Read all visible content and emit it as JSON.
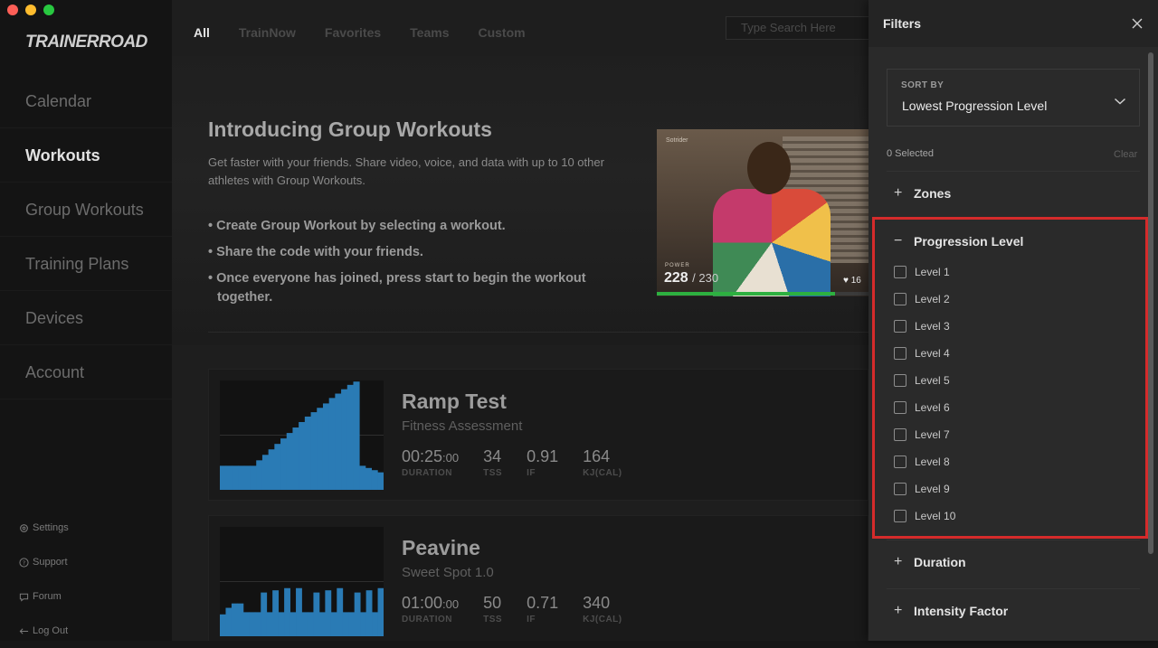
{
  "sidebar": {
    "logo": "TRAINERROAD",
    "nav": [
      "Calendar",
      "Workouts",
      "Group Workouts",
      "Training Plans",
      "Devices",
      "Account"
    ],
    "active_nav": "Workouts",
    "bottom_links": [
      {
        "label": "Settings",
        "icon": "gear-icon"
      },
      {
        "label": "Support",
        "icon": "question-icon"
      },
      {
        "label": "Forum",
        "icon": "chat-icon"
      },
      {
        "label": "Log Out",
        "icon": "arrow-left-icon"
      }
    ]
  },
  "main": {
    "tabs": [
      "All",
      "TrainNow",
      "Favorites",
      "Teams",
      "Custom"
    ],
    "active_tab": "All",
    "search_placeholder": "Type Search Here",
    "hero": {
      "title": "Introducing Group Workouts",
      "description": "Get faster with your friends. Share video, voice, and data with up to 10 other athletes with Group Workouts.",
      "bullets": [
        "• Create Group Workout by selecting a workout.",
        "• Share the code with your friends.",
        "• Once everyone has joined, press start to begin the workout together."
      ],
      "video": {
        "name": "Sotrider",
        "power_label": "POWER",
        "power": "228",
        "target": "/ 230",
        "heart_rate": "♥ 16",
        "progress_fraction": 0.84
      }
    },
    "workouts": [
      {
        "name": "Ramp Test",
        "category": "Fitness Assessment",
        "duration": "00:25",
        "duration_sec": ":00",
        "tss": "34",
        "if": "0.91",
        "kj": "164",
        "profile": [
          0.22,
          0.22,
          0.22,
          0.22,
          0.22,
          0.22,
          0.27,
          0.32,
          0.37,
          0.42,
          0.47,
          0.52,
          0.57,
          0.62,
          0.67,
          0.71,
          0.75,
          0.79,
          0.84,
          0.88,
          0.92,
          0.96,
          0.99,
          0.22,
          0.2,
          0.18,
          0.16
        ]
      },
      {
        "name": "Peavine",
        "category": "Sweet Spot 1.0",
        "duration": "01:00",
        "duration_sec": ":00",
        "tss": "50",
        "if": "0.71",
        "kj": "340",
        "profile": [
          0.2,
          0.26,
          0.3,
          0.3,
          0.22,
          0.22,
          0.22,
          0.4,
          0.22,
          0.42,
          0.22,
          0.44,
          0.22,
          0.44,
          0.22,
          0.22,
          0.4,
          0.22,
          0.42,
          0.22,
          0.44,
          0.22,
          0.22,
          0.4,
          0.22,
          0.42,
          0.22,
          0.44
        ]
      }
    ],
    "stat_labels": {
      "duration": "DURATION",
      "tss": "TSS",
      "if": "IF",
      "kj": "KJ(CAL)"
    }
  },
  "filters": {
    "title": "Filters",
    "sort_by_label": "SORT BY",
    "sort_value": "Lowest Progression Level",
    "selected_text": "0 Selected",
    "clear_label": "Clear",
    "sections": {
      "zones": "Zones",
      "progression": "Progression Level",
      "duration": "Duration",
      "intensity": "Intensity Factor"
    },
    "levels": [
      "Level 1",
      "Level 2",
      "Level 3",
      "Level 4",
      "Level 5",
      "Level 6",
      "Level 7",
      "Level 8",
      "Level 9",
      "Level 10"
    ]
  },
  "colors": {
    "accent_red": "#c72d1f",
    "graph_blue": "#2a7bb5",
    "highlight_border": "#d52b2b",
    "power_bar": "#2db040"
  }
}
